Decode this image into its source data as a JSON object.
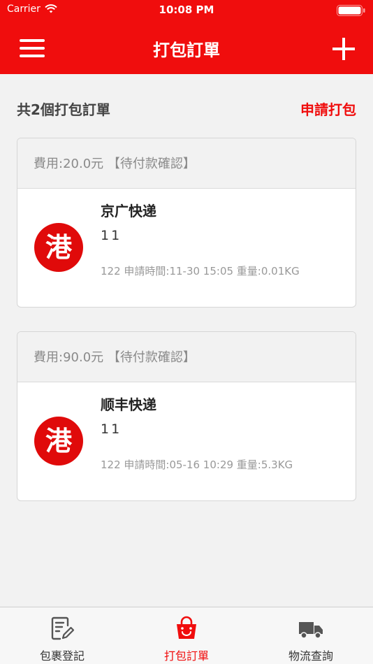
{
  "status_bar": {
    "carrier": "Carrier",
    "time": "10:08 PM"
  },
  "nav": {
    "title": "打包訂單"
  },
  "summary": {
    "text": "共2個打包訂單",
    "action_label": "申請打包"
  },
  "orders": [
    {
      "header": "費用:20.0元 【待付款確認】",
      "logo_char": "港",
      "courier": "京广快递",
      "code": "11",
      "meta": "122 申請時間:11-30 15:05 重量:0.01KG"
    },
    {
      "header": "費用:90.0元 【待付款確認】",
      "logo_char": "港",
      "courier": "顺丰快递",
      "code": "11",
      "meta": "122 申請時間:05-16 10:29 重量:5.3KG"
    }
  ],
  "tabs": [
    {
      "label": "包裹登記",
      "icon": "document-edit-icon"
    },
    {
      "label": "打包訂單",
      "icon": "shopping-bag-icon",
      "active": true
    },
    {
      "label": "物流查詢",
      "icon": "truck-icon"
    }
  ],
  "colors": {
    "primary": "#f00d0d",
    "background": "#f2f2f2"
  }
}
